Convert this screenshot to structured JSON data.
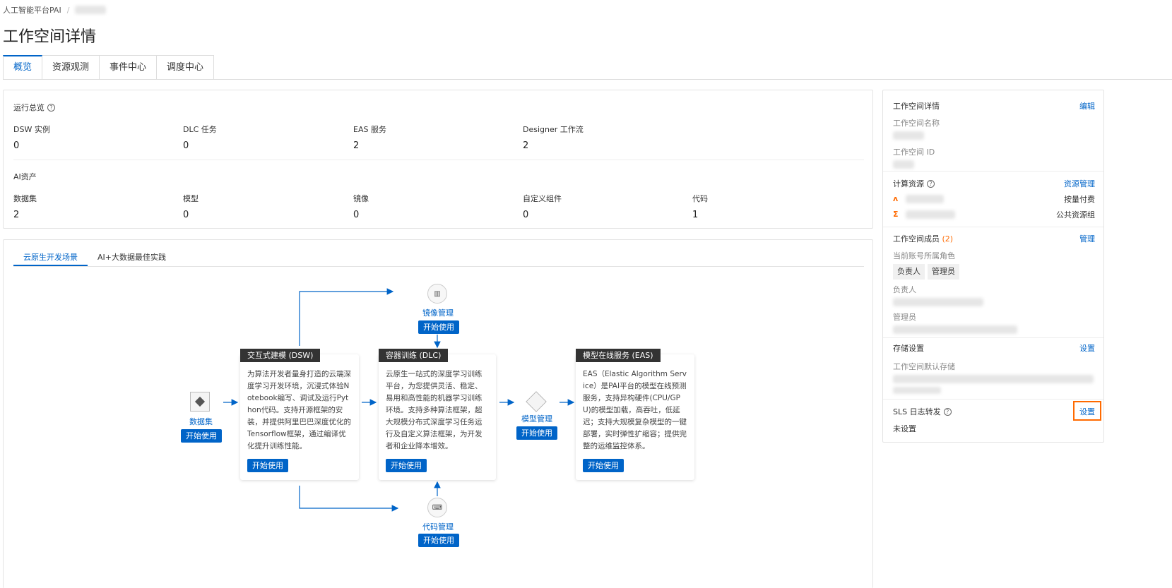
{
  "breadcrumb": {
    "root": "人工智能平台PAI",
    "separator": "/"
  },
  "page": {
    "title": "工作空间详情"
  },
  "tabs": [
    "概览",
    "资源观测",
    "事件中心",
    "调度中心"
  ],
  "overview": {
    "run_title": "运行总览",
    "run_stats": [
      {
        "label": "DSW 实例",
        "value": "0"
      },
      {
        "label": "DLC 任务",
        "value": "0"
      },
      {
        "label": "EAS 服务",
        "value": "2"
      },
      {
        "label": "Designer 工作流",
        "value": "2"
      }
    ],
    "asset_title": "AI资产",
    "asset_stats": [
      {
        "label": "数据集",
        "value": "2"
      },
      {
        "label": "模型",
        "value": "0"
      },
      {
        "label": "镜像",
        "value": "0"
      },
      {
        "label": "自定义组件",
        "value": "0"
      },
      {
        "label": "代码",
        "value": "1"
      }
    ]
  },
  "scene": {
    "subtabs": [
      "云原生开发场景",
      "AI+大数据最佳实践"
    ],
    "start_label": "开始使用",
    "dataset_label": "数据集",
    "image_label": "镜像管理",
    "code_label": "代码管理",
    "model_label": "模型管理",
    "dsw": {
      "title": "交互式建模 (DSW)",
      "desc": "为算法开发者量身打造的云端深度学习开发环境，沉浸式体验Notebook编写、调试及运行Python代码。支持开源框架的安装，并提供阿里巴巴深度优化的Tensorflow框架，通过编译优化提升训练性能。"
    },
    "dlc": {
      "title": "容器训练 (DLC)",
      "desc": "云原生一站式的深度学习训练平台，为您提供灵活、稳定、易用和高性能的机器学习训练环境。支持多种算法框架，超大规模分布式深度学习任务运行及自定义算法框架，为开发者和企业降本增效。"
    },
    "eas": {
      "title": "模型在线服务 (EAS)",
      "desc": "EAS（Elastic Algorithm Service）是PAI平台的模型在线预测服务，支持异构硬件(CPU/GPU)的模型加载，高吞吐，低延迟；支持大规模复杂模型的一键部署，实时弹性扩缩容；提供完整的运维监控体系。"
    }
  },
  "side": {
    "detail_title": "工作空间详情",
    "edit_label": "编辑",
    "name_label": "工作空间名称",
    "id_label": "工作空间 ID",
    "compute_title": "计算资源",
    "resource_manage_label": "资源管理",
    "resources": [
      {
        "billing": "按量付费"
      },
      {
        "billing": "公共资源组"
      }
    ],
    "members_title": "工作空间成员",
    "members_count": "(2)",
    "manage_label": "管理",
    "current_role_label": "当前账号所属角色",
    "roles": [
      "负责人",
      "管理员"
    ],
    "owner_label": "负责人",
    "admin_label": "管理员",
    "storage_title": "存储设置",
    "storage_setting_label": "设置",
    "default_storage_label": "工作空间默认存储",
    "sls_title": "SLS 日志转发",
    "sls_setting_label": "设置",
    "sls_status": "未设置"
  },
  "colors": {
    "accent": "#0064c8",
    "highlight": "#ff6a00"
  }
}
